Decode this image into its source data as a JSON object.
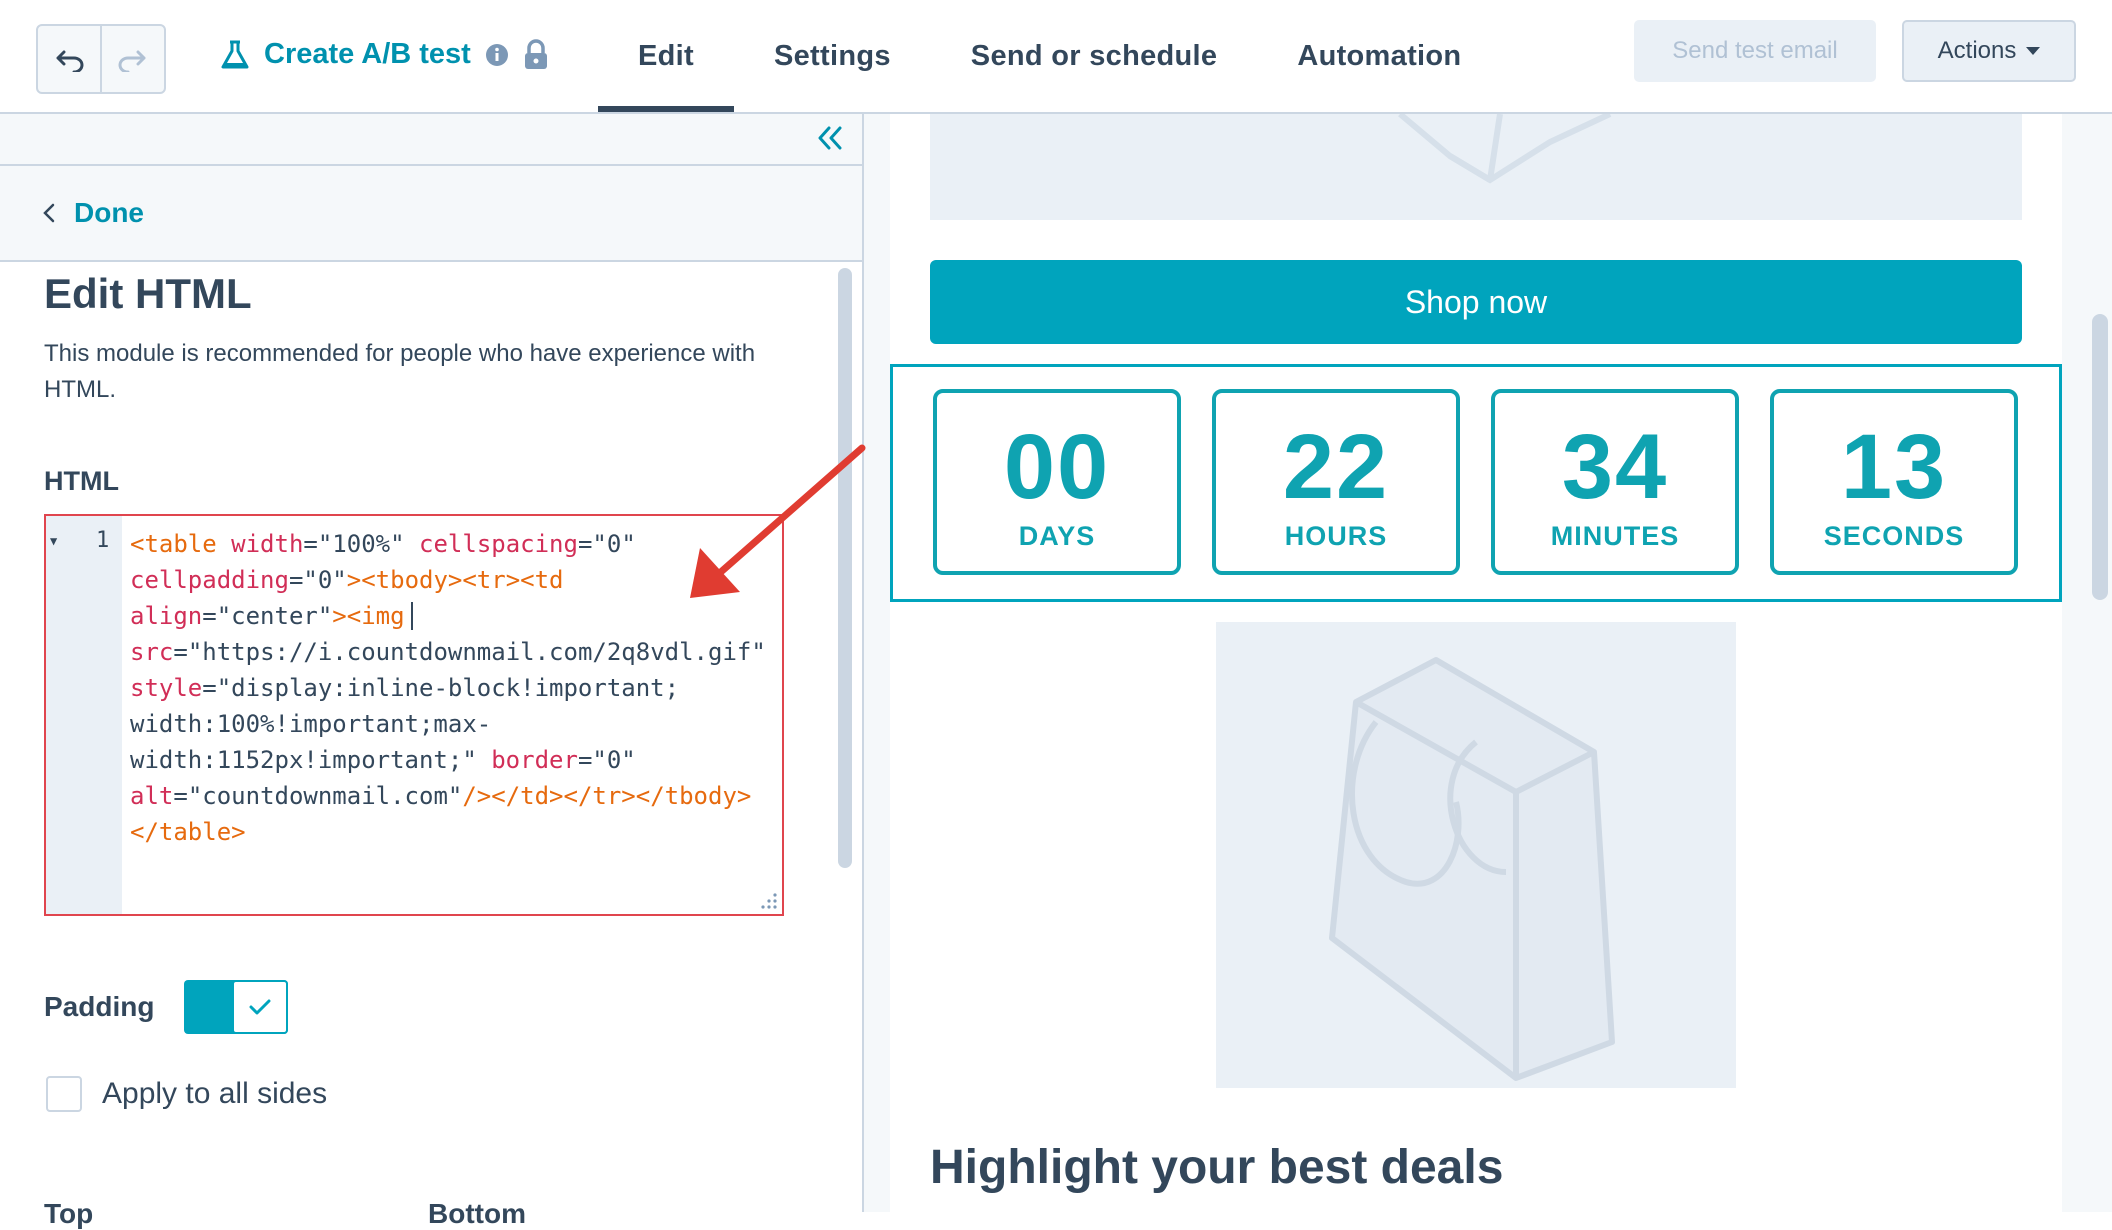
{
  "header": {
    "title": "Create A/B test",
    "tabs": [
      "Edit",
      "Settings",
      "Send or schedule",
      "Automation"
    ],
    "send_test_label": "Send test email",
    "actions_label": "Actions"
  },
  "sidebar": {
    "done_label": "Done",
    "heading": "Edit HTML",
    "description": "This module is recommended for people who have experience with HTML.",
    "html_label": "HTML",
    "line_number": "1",
    "code_src_url": "https://i.countdownmail.com/2q8vdl.gif",
    "code_alt": "countdownmail.com",
    "padding_label": "Padding",
    "apply_all_label": "Apply to all sides",
    "top_label": "Top",
    "bottom_label": "Bottom"
  },
  "preview": {
    "shop_button": "Shop now",
    "countdown": [
      {
        "value": "00",
        "label": "DAYS"
      },
      {
        "value": "22",
        "label": "HOURS"
      },
      {
        "value": "34",
        "label": "MINUTES"
      },
      {
        "value": "13",
        "label": "SECONDS"
      }
    ],
    "heading": "Highlight your best deals"
  },
  "colors": {
    "accent": "#0091ae",
    "button": "#00a4bd",
    "countdown": "#0fa3b1",
    "error_border": "#e0454e",
    "arrow": "#e03c31"
  }
}
